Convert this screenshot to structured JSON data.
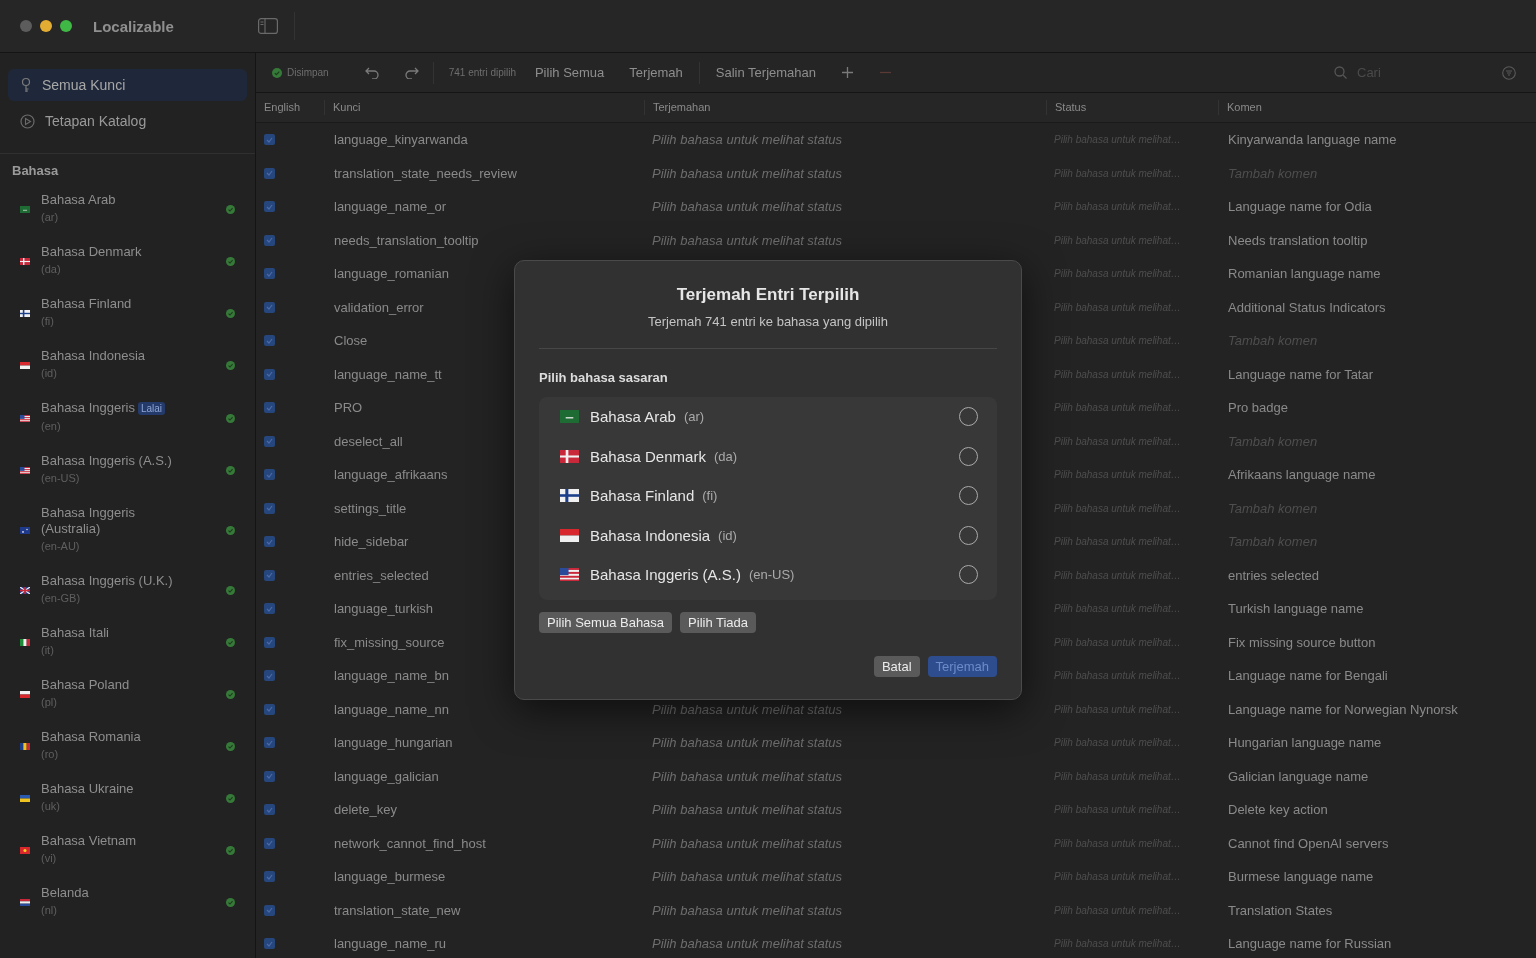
{
  "window": {
    "title": "Localizable"
  },
  "sidebar": {
    "nav": [
      {
        "label": "Semua Kunci",
        "kind": "key",
        "selected": true
      },
      {
        "label": "Tetapan Katalog",
        "kind": "settings",
        "selected": false
      }
    ],
    "section": "Bahasa",
    "languages": [
      {
        "name": "Bahasa Arab",
        "code": "(ar)",
        "kind": "arab"
      },
      {
        "name": "Bahasa Denmark",
        "code": "(da)",
        "kind": "denmark"
      },
      {
        "name": "Bahasa Finland",
        "code": "(fi)",
        "kind": "finland"
      },
      {
        "name": "Bahasa Indonesia",
        "code": "(id)",
        "kind": "indonesia"
      },
      {
        "name": "Bahasa Inggeris",
        "badge": "Lalai",
        "code": "(en)",
        "kind": "us"
      },
      {
        "name": "Bahasa Inggeris (A.S.)",
        "code": "(en-US)",
        "kind": "us"
      },
      {
        "name": "Bahasa Inggeris (Australia)",
        "code": "(en-AU)",
        "kind": "australia"
      },
      {
        "name": "Bahasa Inggeris (U.K.)",
        "code": "(en-GB)",
        "kind": "uk"
      },
      {
        "name": "Bahasa Itali",
        "code": "(it)",
        "kind": "italy"
      },
      {
        "name": "Bahasa Poland",
        "code": "(pl)",
        "kind": "poland"
      },
      {
        "name": "Bahasa Romania",
        "code": "(ro)",
        "kind": "romania"
      },
      {
        "name": "Bahasa Ukraine",
        "code": "(uk)",
        "kind": "ukraine"
      },
      {
        "name": "Bahasa Vietnam",
        "code": "(vi)",
        "kind": "vietnam"
      },
      {
        "name": "Belanda",
        "code": "(nl)",
        "kind": "netherlands"
      }
    ]
  },
  "toolbar": {
    "status": "Disimpan",
    "count": "741 entri dipilih",
    "buttons": [
      "Pilih Semua",
      "Terjemah"
    ],
    "copy": "Salin Terjemahan",
    "search": {
      "placeholder": "Cari"
    }
  },
  "table": {
    "columns": [
      "English",
      "Kunci",
      "Terjemahan",
      "Status",
      "Komen"
    ],
    "rows": [
      {
        "checked": true,
        "key": "language_kinyarwanda",
        "translation": "Pilih bahasa untuk melihat status",
        "status": "Pilih bahasa untuk melihat…",
        "comment": "Kinyarwanda language name",
        "comment_placeholder": false
      },
      {
        "checked": true,
        "key": "translation_state_needs_review",
        "translation": "Pilih bahasa untuk melihat status",
        "status": "Pilih bahasa untuk melihat…",
        "comment": "Tambah komen",
        "comment_placeholder": true
      },
      {
        "checked": true,
        "key": "language_name_or",
        "translation": "Pilih bahasa untuk melihat status",
        "status": "Pilih bahasa untuk melihat…",
        "comment": "Language name for Odia",
        "comment_placeholder": false
      },
      {
        "checked": true,
        "key": "needs_translation_tooltip",
        "translation": "Pilih bahasa untuk melihat status",
        "status": "Pilih bahasa untuk melihat…",
        "comment": "Needs translation tooltip",
        "comment_placeholder": false
      },
      {
        "checked": true,
        "key": "language_romanian",
        "status": "Pilih bahasa untuk melihat…",
        "comment": "Romanian language name",
        "comment_placeholder": false
      },
      {
        "checked": true,
        "key": "validation_error",
        "status": "Pilih bahasa untuk melihat…",
        "comment": "Additional Status Indicators",
        "comment_placeholder": false
      },
      {
        "checked": true,
        "key": "Close",
        "status": "Pilih bahasa untuk melihat…",
        "comment": "Tambah komen",
        "comment_placeholder": true
      },
      {
        "checked": true,
        "key": "language_name_tt",
        "status": "Pilih bahasa untuk melihat…",
        "comment": "Language name for Tatar",
        "comment_placeholder": false
      },
      {
        "checked": true,
        "key": "PRO",
        "status": "Pilih bahasa untuk melihat…",
        "comment": "Pro badge",
        "comment_placeholder": false
      },
      {
        "checked": true,
        "key": "deselect_all",
        "status": "Pilih bahasa untuk melihat…",
        "comment": "Tambah komen",
        "comment_placeholder": true
      },
      {
        "checked": true,
        "key": "language_afrikaans",
        "status": "Pilih bahasa untuk melihat…",
        "comment": "Afrikaans language name",
        "comment_placeholder": false
      },
      {
        "checked": true,
        "key": "settings_title",
        "status": "Pilih bahasa untuk melihat…",
        "comment": "Tambah komen",
        "comment_placeholder": true
      },
      {
        "checked": true,
        "key": "hide_sidebar",
        "status": "Pilih bahasa untuk melihat…",
        "comment": "Tambah komen",
        "comment_placeholder": true
      },
      {
        "checked": true,
        "key": "entries_selected",
        "status": "Pilih bahasa untuk melihat…",
        "comment": "entries selected",
        "comment_placeholder": false
      },
      {
        "checked": true,
        "key": "language_turkish",
        "status": "Pilih bahasa untuk melihat…",
        "comment": "Turkish language name",
        "comment_placeholder": false
      },
      {
        "checked": true,
        "key": "fix_missing_source",
        "status": "Pilih bahasa untuk melihat…",
        "comment": "Fix missing source button",
        "comment_placeholder": false
      },
      {
        "checked": true,
        "key": "language_name_bn",
        "status": "Pilih bahasa untuk melihat…",
        "comment": "Language name for Bengali",
        "comment_placeholder": false
      },
      {
        "checked": true,
        "key": "language_name_nn",
        "translation": "Pilih bahasa untuk melihat status",
        "status": "Pilih bahasa untuk melihat…",
        "comment": "Language name for Norwegian Nynorsk",
        "comment_placeholder": false
      },
      {
        "checked": true,
        "key": "language_hungarian",
        "translation": "Pilih bahasa untuk melihat status",
        "status": "Pilih bahasa untuk melihat…",
        "comment": "Hungarian language name",
        "comment_placeholder": false
      },
      {
        "checked": true,
        "key": "language_galician",
        "translation": "Pilih bahasa untuk melihat status",
        "status": "Pilih bahasa untuk melihat…",
        "comment": "Galician language name",
        "comment_placeholder": false
      },
      {
        "checked": true,
        "key": "delete_key",
        "translation": "Pilih bahasa untuk melihat status",
        "status": "Pilih bahasa untuk melihat…",
        "comment": "Delete key action",
        "comment_placeholder": false
      },
      {
        "checked": true,
        "key": "network_cannot_find_host",
        "translation": "Pilih bahasa untuk melihat status",
        "status": "Pilih bahasa untuk melihat…",
        "comment": "Cannot find OpenAI servers",
        "comment_placeholder": false
      },
      {
        "checked": true,
        "key": "language_burmese",
        "translation": "Pilih bahasa untuk melihat status",
        "status": "Pilih bahasa untuk melihat…",
        "comment": "Burmese language name",
        "comment_placeholder": false
      },
      {
        "checked": true,
        "key": "translation_state_new",
        "translation": "Pilih bahasa untuk melihat status",
        "status": "Pilih bahasa untuk melihat…",
        "comment": "Translation States",
        "comment_placeholder": false
      },
      {
        "checked": true,
        "key": "language_name_ru",
        "translation": "Pilih bahasa untuk melihat status",
        "status": "Pilih bahasa untuk melihat…",
        "comment": "Language name for Russian",
        "comment_placeholder": false
      }
    ]
  },
  "dialog": {
    "title": "Terjemah Entri Terpilih",
    "subtitle": "Terjemah 741 entri ke bahasa yang dipilih",
    "section": "Pilih bahasa sasaran",
    "languages": [
      {
        "name": "Bahasa Arab",
        "code": "(ar)",
        "kind": "arab",
        "selected": false
      },
      {
        "name": "Bahasa Denmark",
        "code": "(da)",
        "kind": "denmark",
        "selected": false
      },
      {
        "name": "Bahasa Finland",
        "code": "(fi)",
        "kind": "finland",
        "selected": false
      },
      {
        "name": "Bahasa Indonesia",
        "code": "(id)",
        "kind": "indonesia",
        "selected": false
      },
      {
        "name": "Bahasa Inggeris (A.S.)",
        "code": "(en-US)",
        "kind": "us",
        "selected": false
      }
    ],
    "list_buttons": [
      "Pilih Semua Bahasa",
      "Pilih Tiada"
    ],
    "buttons": [
      {
        "label": "Batal",
        "kind": "cancel",
        "disabled": false
      },
      {
        "label": "Terjemah",
        "kind": "primary",
        "disabled": true
      }
    ]
  }
}
